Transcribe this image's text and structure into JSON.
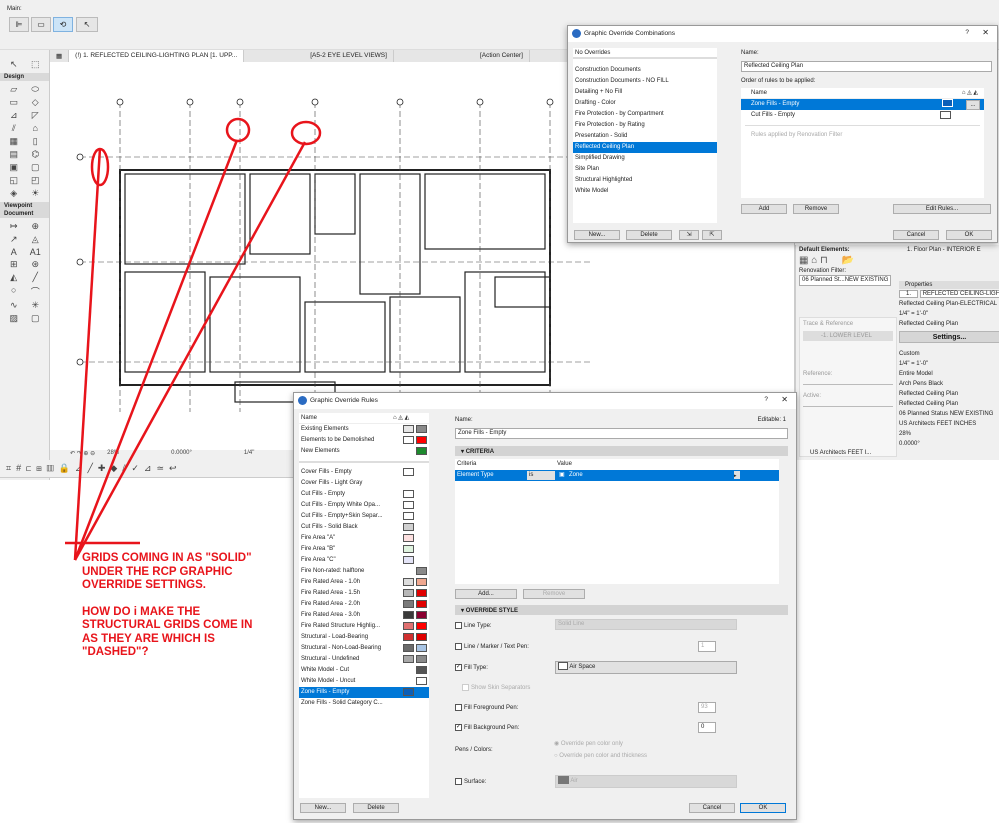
{
  "topbar": {
    "label": "Main:"
  },
  "tabs": [
    {
      "label": "(!) 1. REFLECTED CEILING-LIGHTING PLAN [1. UPP...",
      "active": true
    },
    {
      "label": "[A5-2 EYE LEVEL VIEWS]"
    },
    {
      "label": "[Action Center]"
    }
  ],
  "toolbox": {
    "sections": [
      "Design",
      "Viewpoint",
      "Document"
    ]
  },
  "statusbar": {
    "zoom": "28%",
    "angle": "0.0000°",
    "scale": "1/4\""
  },
  "combinations_dialog": {
    "title": "Graphic Override Combinations",
    "help": "?",
    "close": "✕",
    "top_item": "No Overrides",
    "items": [
      "Construction Documents",
      "Construction Documents - NO FILL",
      "Detailing + No Fill",
      "Drafting - Color",
      "Fire Protection - by Compartment",
      "Fire Protection - by Rating",
      "Presentation - Solid",
      "Reflected Ceiling Plan",
      "Simplified Drawing",
      "Site Plan",
      "Structural Highlighted",
      "White Model"
    ],
    "selected": "Reflected Ceiling Plan",
    "name_label": "Name:",
    "name_value": "Reflected Ceiling Plan",
    "order_label": "Order of rules to be applied:",
    "col_name": "Name",
    "rules": [
      {
        "name": "Zone Fills - Empty",
        "selected": true
      },
      {
        "name": "Cut Fills - Empty"
      }
    ],
    "renovation_note": "Rules applied by Renovation Filter",
    "buttons": {
      "add": "Add",
      "remove": "Remove",
      "edit_rules": "Edit Rules...",
      "new": "New...",
      "delete": "Delete",
      "cancel": "Cancel",
      "ok": "OK",
      "more": "..."
    }
  },
  "right_panel": {
    "default_elements": "Default Elements:",
    "renovation_filter_label": "Renovation Filter:",
    "renovation_filter_value": "06 Planned St...NEW EXISTING",
    "trace_title": "Trace & Reference",
    "trace_level": "-1. LOWER LEVEL",
    "reference": "Reference:",
    "active": "Active:",
    "nav_item": "1. Floor Plan - INTERIOR E",
    "properties": "Properties",
    "view_id": "1.",
    "view_name": "REFLECTED CEILING-LIGHT",
    "lines": [
      "Reflected Ceiling Plan-ELECTRICAL",
      "1/4\"  =  1'-0\"",
      "Reflected Ceiling Plan"
    ],
    "settings": "Settings...",
    "lines2": [
      "Custom",
      "1/4\"  =  1'-0\"",
      "Entire Model",
      "Arch Pens Black",
      "Reflected Ceiling Plan",
      "Reflected Ceiling Plan",
      "06 Planned Status NEW EXISTING",
      "US Architects FEET INCHES",
      "28%",
      "0.0000°"
    ],
    "status_dim": "US Architects FEET I..."
  },
  "rules_dialog": {
    "title": "Graphic Override Rules",
    "help": "?",
    "close": "✕",
    "col_name": "Name",
    "top_items": [
      {
        "name": "Existing Elements",
        "fill": "#e6e6e6",
        "pen": "#8a8a8a"
      },
      {
        "name": "Elements to be Demolished",
        "fill": "#ffffff",
        "pen": "#ff0000"
      },
      {
        "name": "New Elements",
        "pen": "#1e8a2e"
      }
    ],
    "items": [
      {
        "name": "Cover Fills - Empty",
        "fill": "#ffffff"
      },
      {
        "name": "Cover Fills - Light Gray"
      },
      {
        "name": "Cut Fills - Empty",
        "fill": "#ffffff"
      },
      {
        "name": "Cut Fills - Empty White Opa...",
        "fill": "#ffffff"
      },
      {
        "name": "Cut Fills - Empty+Skin Separ...",
        "fill": "#ffffff"
      },
      {
        "name": "Cut Fills - Solid Black",
        "fill": "#d0d0d0"
      },
      {
        "name": "Fire Area \"A\"",
        "fill": "#fde0e0"
      },
      {
        "name": "Fire Area \"B\"",
        "fill": "#dff3df"
      },
      {
        "name": "Fire Area \"C\"",
        "fill": "#e4e4f7"
      },
      {
        "name": "Fire Non-rated: halftone",
        "pen": "#8a8a8a"
      },
      {
        "name": "Fire Rated Area - 1.0h",
        "fill": "#dddddd",
        "pen": "#f0a890"
      },
      {
        "name": "Fire Rated Area - 1.5h",
        "fill": "#b8b8b8",
        "pen": "#e00000"
      },
      {
        "name": "Fire Rated Area - 2.0h",
        "fill": "#7a7a7a",
        "pen": "#e00000"
      },
      {
        "name": "Fire Rated Area - 3.0h",
        "fill": "#3a3a3a",
        "pen": "#8a0030"
      },
      {
        "name": "Fire Rated Structure Highlig...",
        "fill": "#e07070",
        "pen": "#ff0000"
      },
      {
        "name": "Structural - Load-Bearing",
        "fill": "#d03030",
        "pen": "#e00000"
      },
      {
        "name": "Structural - Non-Load-Bearing",
        "fill": "#6a6a6a",
        "pen": "#a8c4e4"
      },
      {
        "name": "Structural - Undefined",
        "fill": "#a8a8a8",
        "pen": "#8a8a8a"
      },
      {
        "name": "White Model - Cut",
        "pen": "#555555"
      },
      {
        "name": "White Model - Uncut",
        "pen": "#ffffff"
      },
      {
        "name": "Zone Fills - Empty",
        "fill": "#0a5fb8",
        "selected": true
      },
      {
        "name": "Zone Fills - Solid Category C..."
      }
    ],
    "buttons": {
      "new": "New...",
      "delete": "Delete",
      "add": "Add...",
      "remove": "Remove",
      "cancel": "Cancel",
      "ok": "OK"
    },
    "name_label": "Name:",
    "editable": "Editable: 1",
    "name_value": "Zone Fills - Empty",
    "criteria_header": "CRITERIA",
    "criteria_cols": [
      "Criteria",
      "Value"
    ],
    "criteria_row": {
      "criteria": "Element Type",
      "op": "is",
      "value": "Zone"
    },
    "override_header": "OVERRIDE STYLE",
    "line_type": {
      "label": "Line Type:",
      "checked": false,
      "value": "Solid Line"
    },
    "line_pen": {
      "label": "Line / Marker / Text Pen:",
      "checked": false,
      "value": "1"
    },
    "fill_type": {
      "label": "Fill Type:",
      "checked": true,
      "value": "Air Space"
    },
    "show_skin": {
      "label": "Show Skin Separators",
      "checked": false
    },
    "fill_fg": {
      "label": "Fill Foreground Pen:",
      "checked": false,
      "value": "93"
    },
    "fill_bg": {
      "label": "Fill Background Pen:",
      "checked": true,
      "value": "0"
    },
    "pens_colors": {
      "label": "Pens / Colors:",
      "opt1": "Override pen color only",
      "opt2": "Override pen color and thickness"
    },
    "surface": {
      "label": "Surface:",
      "checked": false,
      "value": "Air"
    }
  },
  "annotation": {
    "color": "#e8141b",
    "line1": "GRIDS COMING IN AS \"SOLID\"",
    "line2": "UNDER THE RCP GRAPHIC",
    "line3": "OVERRIDE SETTINGS.",
    "line4": "HOW DO i MAKE THE",
    "line5": "STRUCTURAL GRIDS COME IN",
    "line6": "AS THEY ARE WHICH IS",
    "line7": "\"DASHED\"?"
  }
}
